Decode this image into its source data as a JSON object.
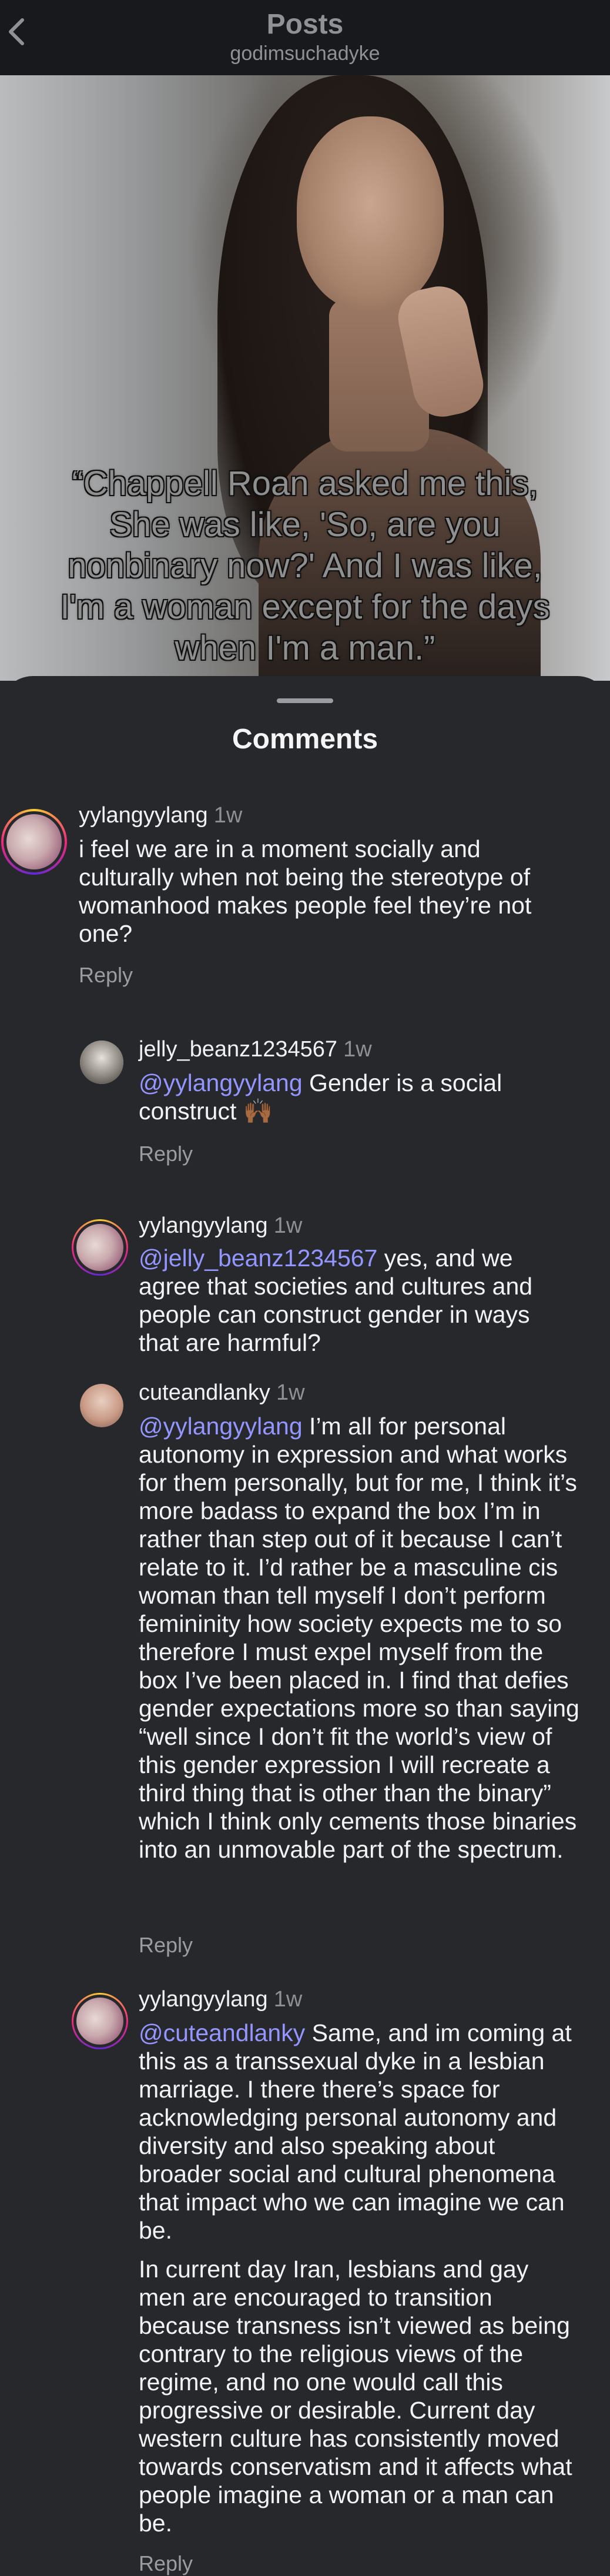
{
  "header": {
    "title": "Posts",
    "subtitle": "godimsuchadyke",
    "back_icon": "chevron-left-icon"
  },
  "post": {
    "caption": "“Chappell Roan asked me this, She was like, 'So, are you nonbinary now?' And I was like, I'm a woman except for the days when I'm a man.”"
  },
  "comments_sheet": {
    "title": "Comments",
    "reply_label": "Reply",
    "comments": [
      {
        "username": "yylangyylang",
        "time": "1w",
        "mention": "",
        "text": "i feel we are in a moment socially and culturally when not being the stereotype of womanhood makes people feel they’re not one?",
        "reply": "Reply"
      },
      {
        "username": "jelly_beanz1234567",
        "time": "1w",
        "mention": "@yylangyylang",
        "text": " Gender is a social construct 🙌🏾",
        "reply": "Reply"
      },
      {
        "username": "yylangyylang",
        "time": "1w",
        "mention": "@jelly_beanz1234567",
        "text": " yes, and we agree that societies and cultures and people can construct gender in ways that are harmful?",
        "reply": ""
      },
      {
        "username": "cuteandlanky",
        "time": "1w",
        "mention": "@yylangyylang",
        "text": " I’m all for personal autonomy in expression and what works for them personally, but for me, I think it’s more badass to expand the box I’m in rather than step out of it because I can’t relate to it. I’d rather be a masculine cis woman than tell myself I don’t perform femininity how society expects me to so therefore I must expel myself from the box I’ve been placed in. I find that defies gender expectations more so than saying “well since I don’t fit the world’s view of this gender expression I will recreate a third thing that is other than the binary” which I think only cements those binaries into an unmovable part of the spectrum.",
        "reply": "Reply"
      },
      {
        "username": "yylangyylang",
        "time": "1w",
        "mention": "@cuteandlanky",
        "text": " Same, and im coming at this as a transsexual dyke in a lesbian marriage. I there there’s space for acknowledging personal autonomy and diversity and also speaking about broader social and cultural phenomena that impact who we can imagine we can be.",
        "text2": "In current day Iran, lesbians and gay men are encouraged to transition because transness isn’t viewed as being contrary to the religious views of the regime, and no one would call this progressive or desirable. Current day western culture has consistently moved towards conservatism and it affects what people imagine a woman or a man can be.",
        "reply": "Reply"
      }
    ]
  },
  "colors": {
    "background": "#26282b",
    "header_bg": "#17191c",
    "mention": "#9496ff",
    "muted": "#8e9095"
  }
}
